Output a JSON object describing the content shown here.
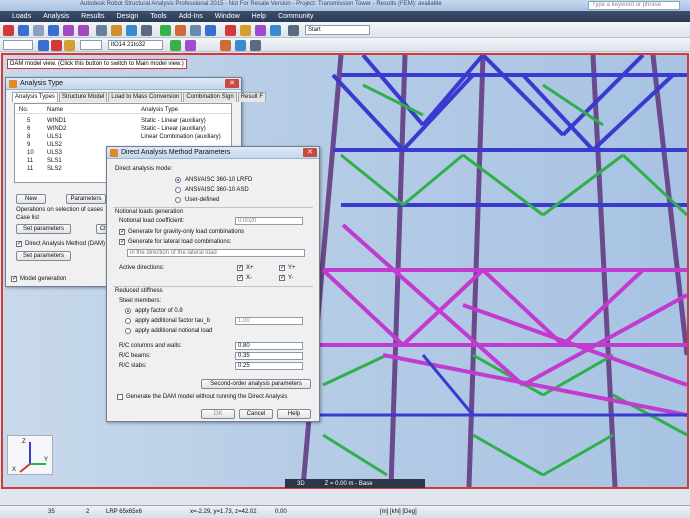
{
  "window": {
    "title": "Autodesk Robot Structural Analysis Professional 2015 - Not For Resale Version - Project: Transmission Tower - Results (FEM): available",
    "search_placeholder": "Type a keyword or phrase"
  },
  "menu": [
    "Loads",
    "Analysis",
    "Results",
    "Design",
    "Tools",
    "Add-Ins",
    "Window",
    "Help",
    "Community"
  ],
  "toolbar": {
    "combo_value": "ltO14  21to32",
    "start_combo": "Start"
  },
  "viewport": {
    "dam_button": "DAM model view.  (Click this button to switch to Main model view.)",
    "view_mode": "3D",
    "level": "Z = 0.00 m - Base",
    "axes": {
      "z": "Z",
      "y": "Y",
      "x": "X"
    }
  },
  "analysis_dialog": {
    "title": "Analysis Type",
    "tabs": [
      "Analysis Types",
      "Structure Model",
      "Load to Mass Conversion",
      "Combination Sign",
      "Result F"
    ],
    "columns": {
      "no": "No.",
      "name": "Name",
      "type": "Analysis Type"
    },
    "rows": [
      {
        "no": "5",
        "name": "WIND1",
        "type": "Static - Linear (auxiliary)"
      },
      {
        "no": "6",
        "name": "WIND2",
        "type": "Static - Linear (auxiliary)"
      },
      {
        "no": "8",
        "name": "ULS1",
        "type": "Linear Combination (auxiliary)"
      },
      {
        "no": "9",
        "name": "ULS2",
        "type": ""
      },
      {
        "no": "10",
        "name": "ULS3",
        "type": ""
      },
      {
        "no": "11",
        "name": "SLS1",
        "type": ""
      },
      {
        "no": "11",
        "name": "SLS2",
        "type": ""
      }
    ],
    "new_btn": "New",
    "params_btn": "Parameters",
    "ops_label": "Operations on selection of cases",
    "case_list": "Case list",
    "set_params_btn": "Set parameters",
    "change_btn": "Chan",
    "dam_check": "Direct Analysis Method (DAM)",
    "dam_set_btn": "Set parameters",
    "model_gen": "Model generation"
  },
  "dam_dialog": {
    "title": "Direct Analysis Method Parameters",
    "mode_label": "Direct analysis mode:",
    "modes": [
      "ANSI/AISC 360-10 LRFD",
      "ANSI/AISC 360-10 ASD",
      "User-defined"
    ],
    "notional_label": "Notional loads generation",
    "coef_label": "Notional load coefficient:",
    "coef_value": "0.0020",
    "gravity_check": "Generate for gravity-only load combinations",
    "lateral_check": "Generate for lateral load combinations:",
    "lateral_combo": "in the direction of the lateral load",
    "directions_label": "Active directions:",
    "directions": [
      "X+",
      "Y+",
      "X-",
      "Y-"
    ],
    "stiffness_label": "Reduced stiffness",
    "steel_label": "Steel members:",
    "steel_opts": [
      "apply factor of 0.8",
      "apply additional factor tau_b",
      "apply additional notional load"
    ],
    "tau_value": "1.00",
    "rc_cols_label": "R/C columns and walls:",
    "rc_cols_value": "0.80",
    "rc_beams_label": "R/C beams:",
    "rc_beams_value": "0.35",
    "rc_slabs_label": "R/C slabs:",
    "rc_slabs_value": "0.25",
    "second_order_btn": "Second-order analysis parameters",
    "gen_only_check": "Generate the DAM model without running the Direct Analysis",
    "ok": "OK",
    "cancel": "Cancel",
    "help": "Help"
  },
  "status": {
    "a": "35",
    "b": "2",
    "section": "LRP 65x65x6",
    "coords": "x=-2.29, y=1.73, z=42.02",
    "zero": "0.00",
    "units": "[m] [kN] [Deg]"
  },
  "colors": {
    "accent": "#d23a3a",
    "members_blue": "#3a3ad0",
    "members_green": "#2fb04a",
    "members_magenta": "#c23ad0",
    "members_purple": "#6a4a8c"
  }
}
